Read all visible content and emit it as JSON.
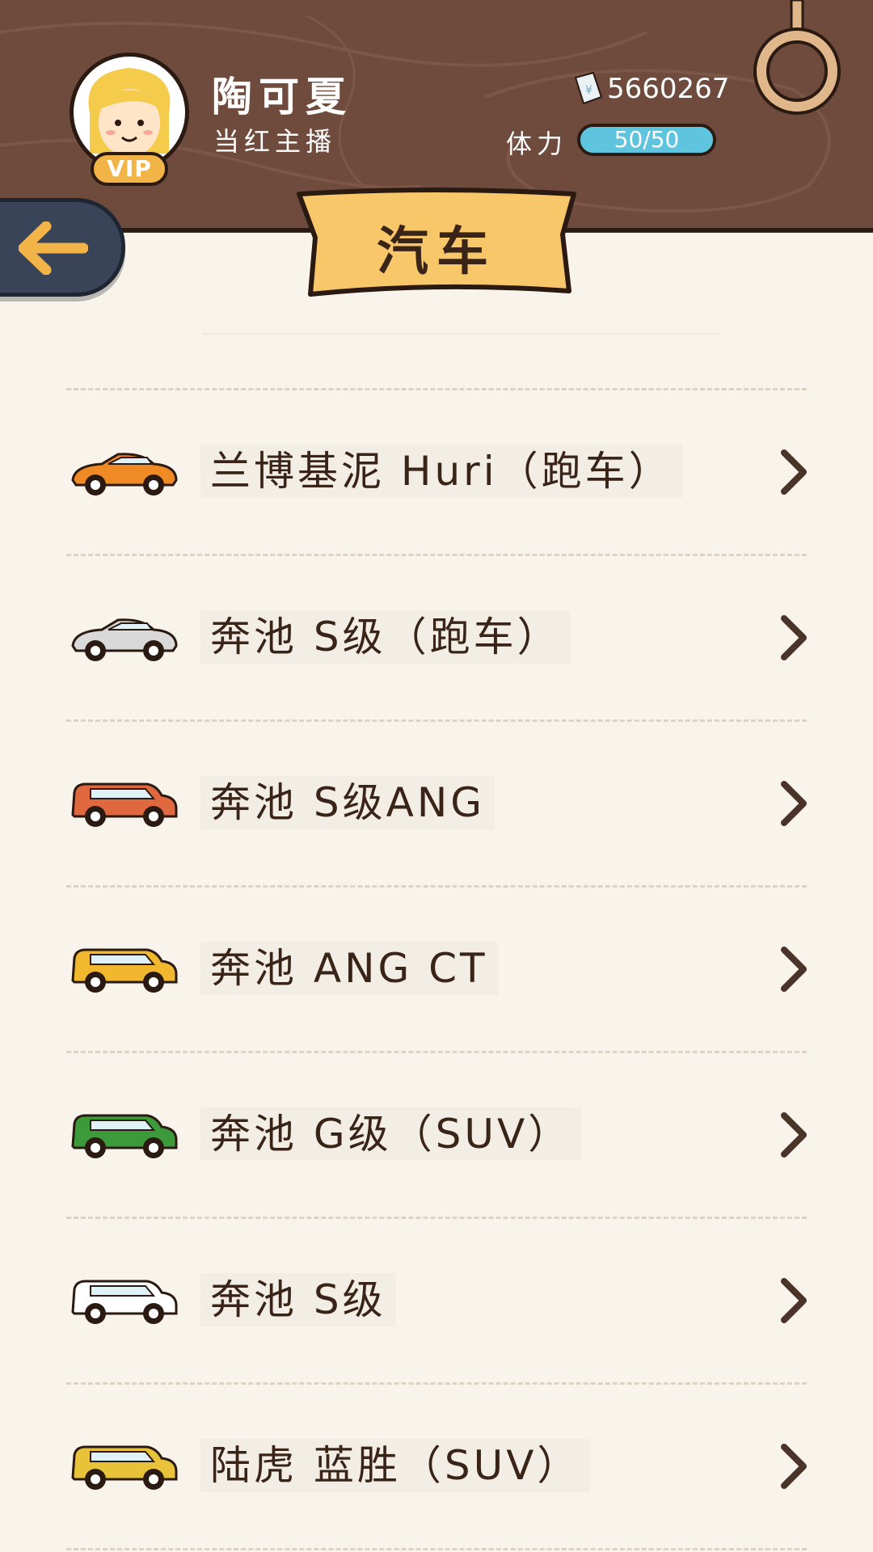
{
  "header": {
    "player_name": "陶可夏",
    "player_title": "当红主播",
    "vip_label": "VIP",
    "money": "5660267",
    "stamina_label": "体力",
    "stamina_text": "50/50",
    "stamina_fraction": 1.0
  },
  "banner": {
    "title": "汽车"
  },
  "colors": {
    "wood": "#6e4b3c",
    "paper": "#f8f4ec",
    "banner": "#f7c76a",
    "text": "#3a2418",
    "stamina": "#5fc4de",
    "back_button": "#3a4458",
    "back_arrow": "#f3b447"
  },
  "cars": [
    {
      "label": "兰博基泥 Huri（跑车）",
      "icon": "orange-sports-car-icon",
      "color": "#f08a24"
    },
    {
      "label": "奔池 S级（跑车）",
      "icon": "silver-convertible-icon",
      "color": "#d9d9d9"
    },
    {
      "label": "奔池 S级ANG",
      "icon": "red-suv-icon",
      "color": "#e0683f"
    },
    {
      "label": "奔池 ANG CT",
      "icon": "yellow-suv-icon",
      "color": "#f1b72f"
    },
    {
      "label": "奔池 G级（SUV）",
      "icon": "green-suv-icon",
      "color": "#3d9a3a"
    },
    {
      "label": "奔池 S级",
      "icon": "white-suv-icon",
      "color": "#ffffff"
    },
    {
      "label": "陆虎 蓝胜（SUV）",
      "icon": "yellow-jeep-icon",
      "color": "#e8c33a"
    }
  ]
}
